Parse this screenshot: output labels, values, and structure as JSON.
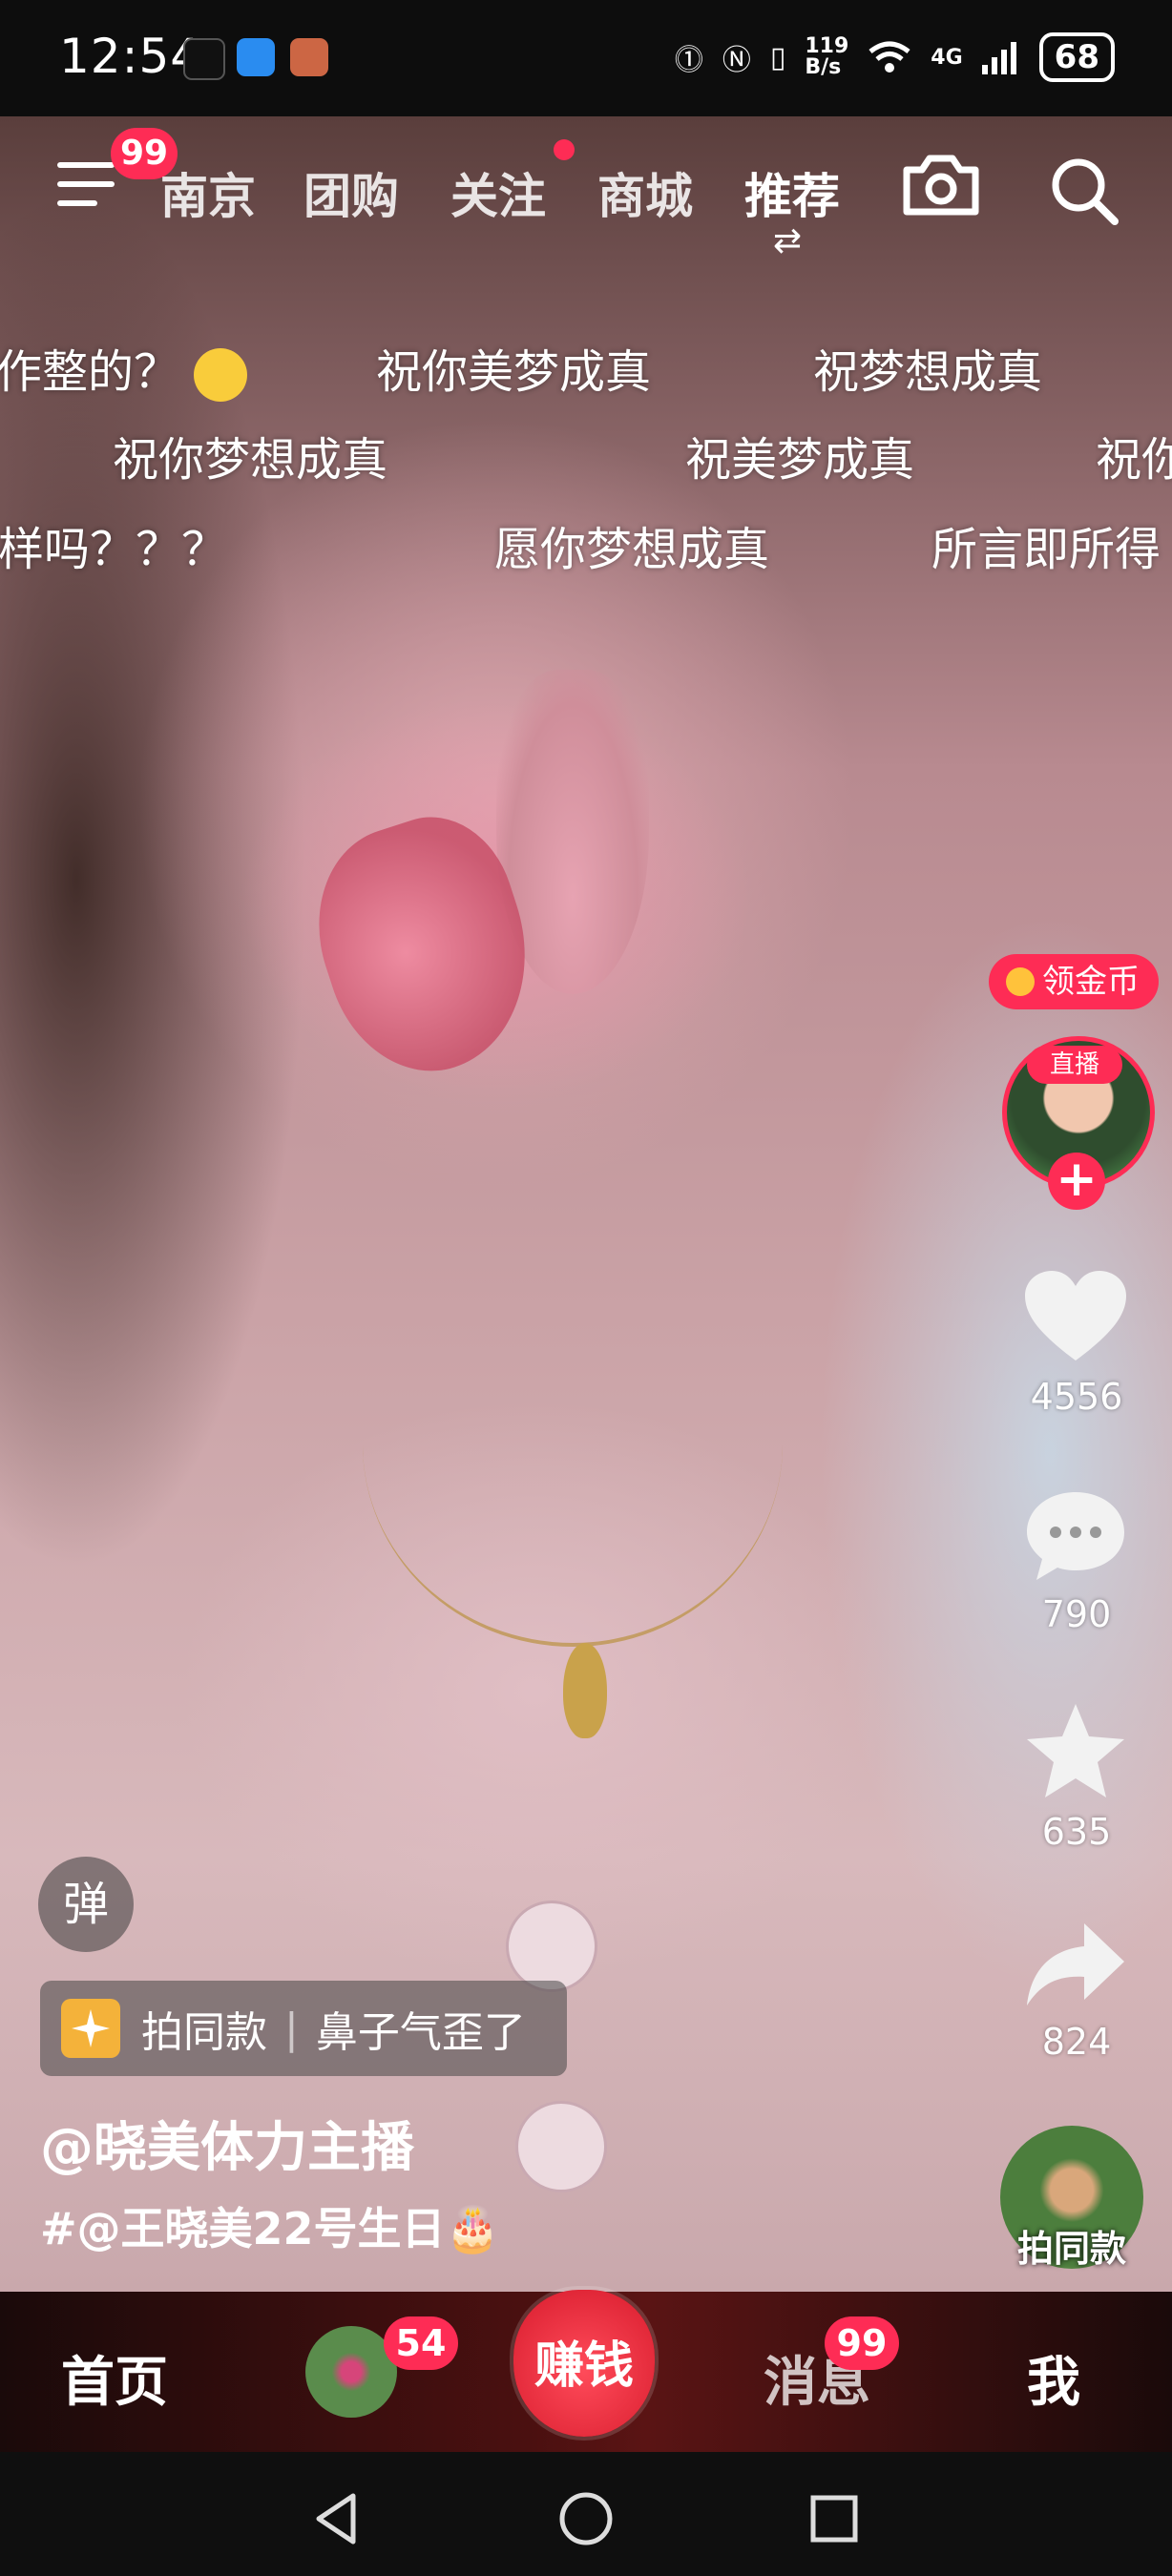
{
  "status_bar": {
    "time": "12:54",
    "network_speed_value": "119",
    "network_speed_unit": "B/s",
    "signal": "4G",
    "battery": "68"
  },
  "top_nav": {
    "menu_badge": "99",
    "tabs": [
      {
        "label": "南京"
      },
      {
        "label": "团购"
      },
      {
        "label": "关注"
      },
      {
        "label": "商城"
      },
      {
        "label": "推荐"
      }
    ],
    "active_tab": "推荐",
    "switch_glyph": "⇄"
  },
  "danmaku": [
    "作整的？",
    "祝你美梦成真",
    "祝梦想成真",
    "祝你梦想成真",
    "祝美梦成真",
    "祝你",
    "样吗？？？",
    "愿你梦想成真",
    "所言即所得"
  ],
  "right_rail": {
    "coin_label": "领金币",
    "live_tag": "直播",
    "follow_glyph": "+",
    "likes": "4556",
    "comments": "790",
    "favorites": "635",
    "shares": "824"
  },
  "video_info": {
    "danmu_toggle": "弹",
    "template_label": "拍同款",
    "template_title": "鼻子气歪了",
    "author": "@晓美体力主播",
    "hashtag": "#@王晓美22号生日🎂"
  },
  "music": {
    "label": "拍同款"
  },
  "bottom_tabs": {
    "home": "首页",
    "friends_badge": "54",
    "earn": "赚钱",
    "messages": "消息",
    "messages_badge": "99",
    "me": "我"
  },
  "colors": {
    "accent": "#fe2c55",
    "coin": "#ffc23b"
  }
}
